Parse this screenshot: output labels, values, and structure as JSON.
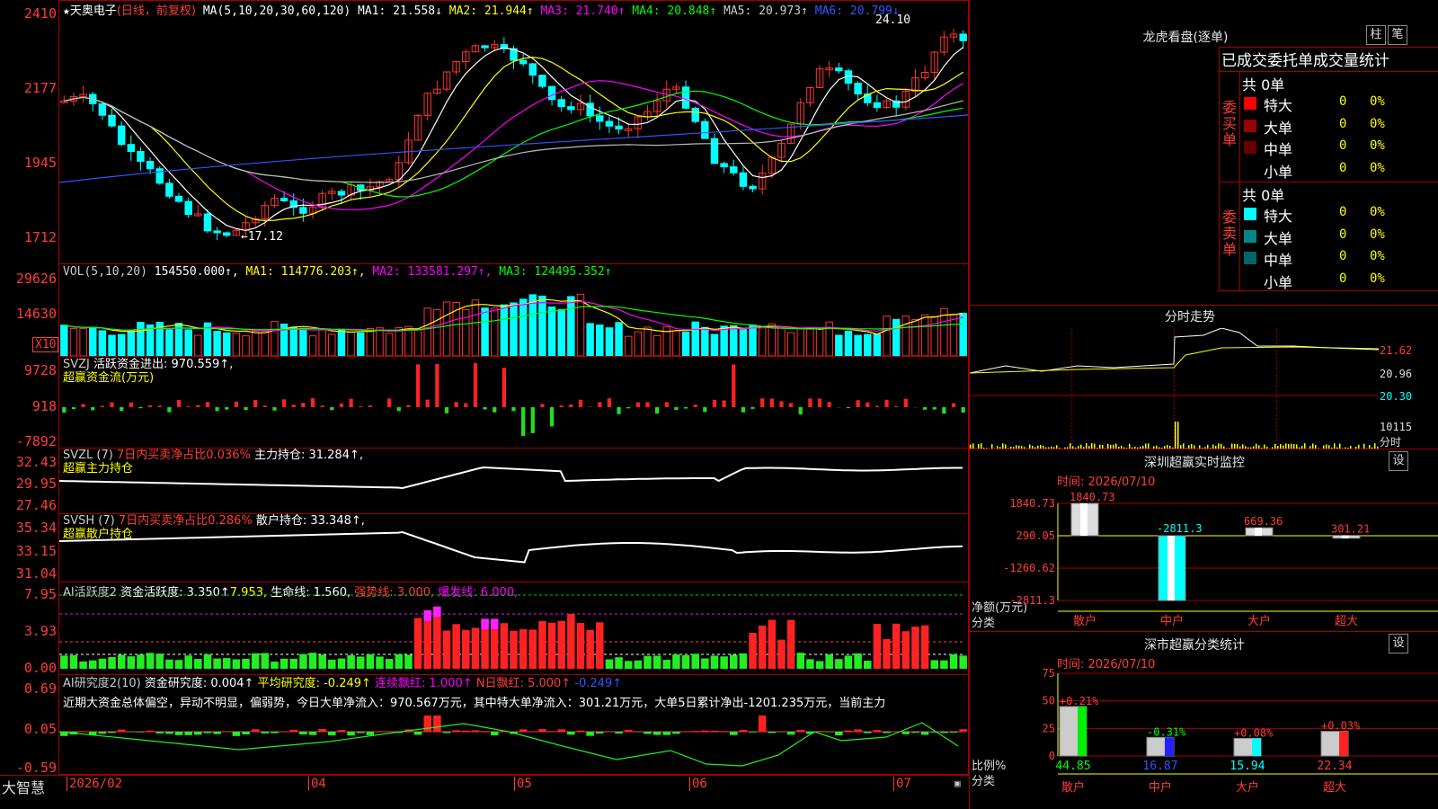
{
  "stock": {
    "name": "天奥电子",
    "period_label": "(日线，前复权)",
    "ma_title": "MA(5,10,20,30,60,120)",
    "ma_values": [
      {
        "label": "MA1: 21.558↓",
        "color": "#ffffff"
      },
      {
        "label": "MA2: 21.944↑",
        "color": "#ffff00"
      },
      {
        "label": "MA3: 21.740↑",
        "color": "#ff00ff"
      },
      {
        "label": "MA4: 20.848↑",
        "color": "#00ff00"
      },
      {
        "label": "MA5: 20.973↑",
        "color": "#cccccc"
      },
      {
        "label": "MA6: 20.799↓",
        "color": "#3355ff"
      }
    ],
    "high_label": "24.10",
    "low_label": "←17.12",
    "price_axis": [
      "2410",
      "2177",
      "1945",
      "1712"
    ]
  },
  "vol": {
    "title": "VOL(5,10,20)",
    "value": "154550.000↑,",
    "ma1": "MA1: 114776.203↑,",
    "ma2": "MA2: 133581.297↑,",
    "ma3": "MA3: 124495.352↑",
    "axis": [
      "29626",
      "14630"
    ],
    "unit": "X10"
  },
  "svzj": {
    "title": "SVZJ",
    "text1": "活跃资金进出: 970.559↑,",
    "text2": "超赢资金流(万元)",
    "axis": [
      "9728",
      "918",
      "-7892"
    ]
  },
  "svzl": {
    "title": "SVZL (7)",
    "red_text": "7日内买卖净占比0.036%",
    "text1": "主力持仓: 31.284↑,",
    "text2": "超赢主力持仓",
    "axis": [
      "32.43",
      "29.95",
      "27.46"
    ]
  },
  "svsh": {
    "title": "SVSH (7)",
    "red_text": "7日内买卖净占比0.286%",
    "text1": "散户持仓: 33.348↑,",
    "text2": "超赢散户持仓",
    "axis": [
      "35.34",
      "33.15",
      "31.04"
    ]
  },
  "ai_active": {
    "title": "AI活跃度2",
    "t1": "资金活跃度: 3.350↑",
    "t2": "7.953,",
    "t3": "生命线: 1.560,",
    "t4": "强势线: 3.000,",
    "t5": "爆发线: 6.000,",
    "axis": [
      "7.95",
      "3.93",
      "0.00"
    ]
  },
  "ai_research": {
    "title": "AI研究度2(10)",
    "t1": "资金研究度: 0.004↑",
    "t2": "平均研究度: -0.249↑",
    "t3": "连续飘红: 1.000↑",
    "t4": "N日飘红: 5.000↑",
    "t5": "-0.249↑",
    "summary": "近期大资金总体偏空，异动不明显，偏弱势，今日大单净流入：970.567万元，其中特大单净流入：301.21万元，大单5日累计净出-1201.235万元，当前主力",
    "axis": [
      "0.69",
      "0.05",
      "-0.59"
    ]
  },
  "bottom": {
    "brand": "大智慧",
    "dates": [
      "2026/02",
      "04",
      "05",
      "06",
      "07"
    ]
  },
  "lhb": {
    "title": "龙虎看盘(逐单)",
    "btn_bar": "柱",
    "btn_stroke": "笔",
    "header": "已成交委托单成交量统计",
    "buy_label": "委买单",
    "sell_label": "委卖单",
    "buy_total": "共 0单",
    "sell_total": "共 0单",
    "buy_rows": [
      {
        "name": "特大",
        "count": "0",
        "pct": "0%",
        "color": "#ff0000"
      },
      {
        "name": "大单",
        "count": "0",
        "pct": "0%",
        "color": "#990000"
      },
      {
        "name": "中单",
        "count": "0",
        "pct": "0%",
        "color": "#660000"
      },
      {
        "name": "小单",
        "count": "0",
        "pct": "0%",
        "color": "#000000"
      }
    ],
    "sell_rows": [
      {
        "name": "特大",
        "count": "0",
        "pct": "0%",
        "color": "#00ffff"
      },
      {
        "name": "大单",
        "count": "0",
        "pct": "0%",
        "color": "#008888"
      },
      {
        "name": "中单",
        "count": "0",
        "pct": "0%",
        "color": "#006666"
      },
      {
        "name": "小单",
        "count": "0",
        "pct": "0%",
        "color": "#000000"
      }
    ]
  },
  "intraday": {
    "title": "分时走势",
    "axis": [
      "21.62",
      "20.96",
      "20.30",
      "10115"
    ],
    "unit": "分时"
  },
  "monitor": {
    "title": "深圳超赢实时监控",
    "settings": "设",
    "date": "时间: 2026/07/10",
    "axis": [
      "1840.73",
      "290.05",
      "-1260.62",
      "-2811.3"
    ],
    "ylabel": "净额(万元)",
    "xlabel": "分类",
    "categories": [
      "散户",
      "中户",
      "大户",
      "超大"
    ],
    "bar_labels": [
      "1840.73",
      "-2811.3",
      "669.36",
      "301.21"
    ]
  },
  "classify": {
    "title": "深市超赢分类统计",
    "settings": "设",
    "date": "时间: 2026/07/10",
    "axis": [
      "75",
      "50",
      "25",
      "0"
    ],
    "ylabel": "比例%",
    "xlabel": "分类",
    "categories": [
      "散户",
      "中户",
      "大户",
      "超大"
    ],
    "change_labels": [
      "+0.21%",
      "-0.31%",
      "+0.08%",
      "+0.03%"
    ],
    "value_labels": [
      "44.85",
      "16.87",
      "15.94",
      "22.34"
    ]
  },
  "chart_data": [
    {
      "type": "bar",
      "title": "深圳超赢实时监控",
      "xlabel": "分类",
      "ylabel": "净额(万元)",
      "categories": [
        "散户",
        "中户",
        "大户",
        "超大"
      ],
      "values": [
        1840.73,
        -2811.3,
        669.36,
        301.21
      ],
      "ylim": [
        -2811.3,
        1840.73
      ]
    },
    {
      "type": "bar",
      "title": "深市超赢分类统计",
      "xlabel": "分类",
      "ylabel": "比例%",
      "categories": [
        "散户",
        "中户",
        "大户",
        "超大"
      ],
      "values": [
        44.85,
        16.87,
        15.94,
        22.34
      ],
      "ylim": [
        0,
        75
      ]
    }
  ]
}
